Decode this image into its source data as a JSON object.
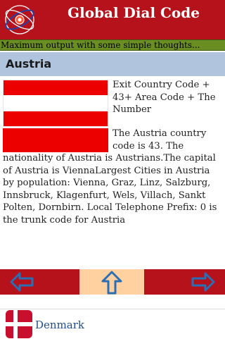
{
  "app": {
    "title": "Global Dial Code",
    "logo": "globe-phone-logo"
  },
  "ad": {
    "text": "Maximum output with some simple thoughts..."
  },
  "country": {
    "name": "Austria",
    "flag_caption": "Exit Country Code + 43+ Area Code + The Number",
    "description": "The Austria country code is 43. The nationality of Austria is Austrians.The capital of Austria is ViennaLargest Cities in Austria by population: Vienna, Graz, Linz, Salzburg, Innsbruck, Klagenfurt, Wels, Villach, Sankt Polten, Dornbirn. Local Telephone Prefix: 0 is the trunk code for Austria"
  },
  "nav": {
    "prev_icon": "arrow-left-icon",
    "up_icon": "arrow-up-icon",
    "next_icon": "arrow-right-icon"
  },
  "next_country": {
    "name": "Denmark",
    "icon": "denmark-flag-icon"
  },
  "colors": {
    "header": "#b5121b",
    "ad_banner": "#6b8e23",
    "country_bar": "#b0c4de",
    "nav_center": "#ffd0a0",
    "arrow": "#2a6fb5",
    "link": "#1f4f8f"
  }
}
